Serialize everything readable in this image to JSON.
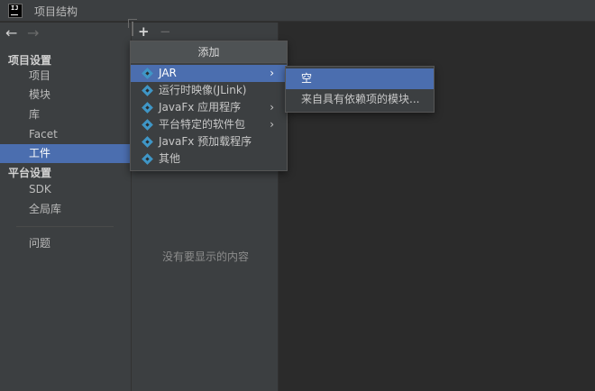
{
  "window": {
    "title": "项目结构",
    "logo_text": "IJ"
  },
  "navigation": {
    "back_icon": "←",
    "forward_icon": "→"
  },
  "sidebar": {
    "project_settings_label": "项目设置",
    "project_items": [
      "项目",
      "模块",
      "库",
      "Facet",
      "工件"
    ],
    "selected_item": "工件",
    "platform_settings_label": "平台设置",
    "platform_items": [
      "SDK",
      "全局库"
    ],
    "problems_label": "问题"
  },
  "toolbar": {
    "add_icon": "+",
    "remove_icon": "−"
  },
  "artifact_panel": {
    "empty_text": "没有要显示的内容"
  },
  "add_popup": {
    "title": "添加",
    "items": [
      {
        "label": "JAR",
        "submenu": true,
        "highlighted": true
      },
      {
        "label": "运行时映像(JLink)",
        "submenu": false
      },
      {
        "label": "JavaFx 应用程序",
        "submenu": true
      },
      {
        "label": "平台特定的软件包",
        "submenu": true
      },
      {
        "label": "JavaFx 预加载程序",
        "submenu": false
      },
      {
        "label": "其他",
        "submenu": false
      }
    ],
    "chevron": "›"
  },
  "jar_submenu": {
    "items": [
      "空",
      "来自具有依赖项的模块..."
    ]
  },
  "colors": {
    "selection": "#4b6eaf",
    "panel": "#3c3f41",
    "background": "#2b2b2b",
    "artifact_icon": "#3f96c6"
  }
}
